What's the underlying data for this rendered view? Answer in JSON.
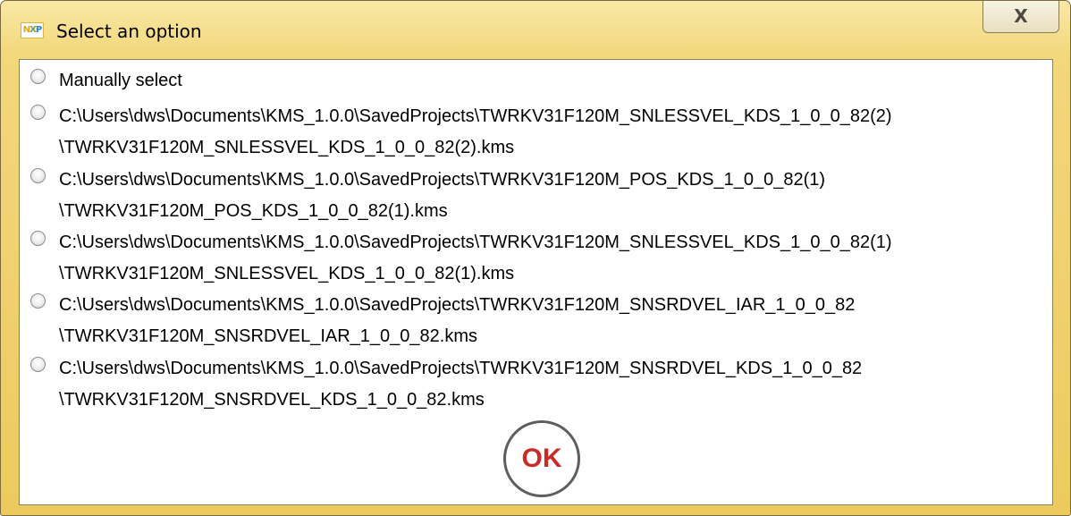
{
  "window": {
    "title": "Select an option",
    "close_glyph": "X",
    "app_icon": {
      "n": "N",
      "x": "X",
      "p": "P"
    }
  },
  "options": [
    {
      "line1": "Manually select",
      "line2": ""
    },
    {
      "line1": "C:\\Users\\dws\\Documents\\KMS_1.0.0\\SavedProjects\\TWRKV31F120M_SNLESSVEL_KDS_1_0_0_82(2)",
      "line2": "\\TWRKV31F120M_SNLESSVEL_KDS_1_0_0_82(2).kms"
    },
    {
      "line1": "C:\\Users\\dws\\Documents\\KMS_1.0.0\\SavedProjects\\TWRKV31F120M_POS_KDS_1_0_0_82(1)",
      "line2": "\\TWRKV31F120M_POS_KDS_1_0_0_82(1).kms"
    },
    {
      "line1": "C:\\Users\\dws\\Documents\\KMS_1.0.0\\SavedProjects\\TWRKV31F120M_SNLESSVEL_KDS_1_0_0_82(1)",
      "line2": "\\TWRKV31F120M_SNLESSVEL_KDS_1_0_0_82(1).kms"
    },
    {
      "line1": "C:\\Users\\dws\\Documents\\KMS_1.0.0\\SavedProjects\\TWRKV31F120M_SNSRDVEL_IAR_1_0_0_82",
      "line2": "\\TWRKV31F120M_SNSRDVEL_IAR_1_0_0_82.kms"
    },
    {
      "line1": "C:\\Users\\dws\\Documents\\KMS_1.0.0\\SavedProjects\\TWRKV31F120M_SNSRDVEL_KDS_1_0_0_82",
      "line2": "\\TWRKV31F120M_SNSRDVEL_KDS_1_0_0_82.kms"
    }
  ],
  "ok_label": "OK",
  "colors": {
    "titlebar": "#f2d77c",
    "ok_text": "#c92a2a"
  }
}
